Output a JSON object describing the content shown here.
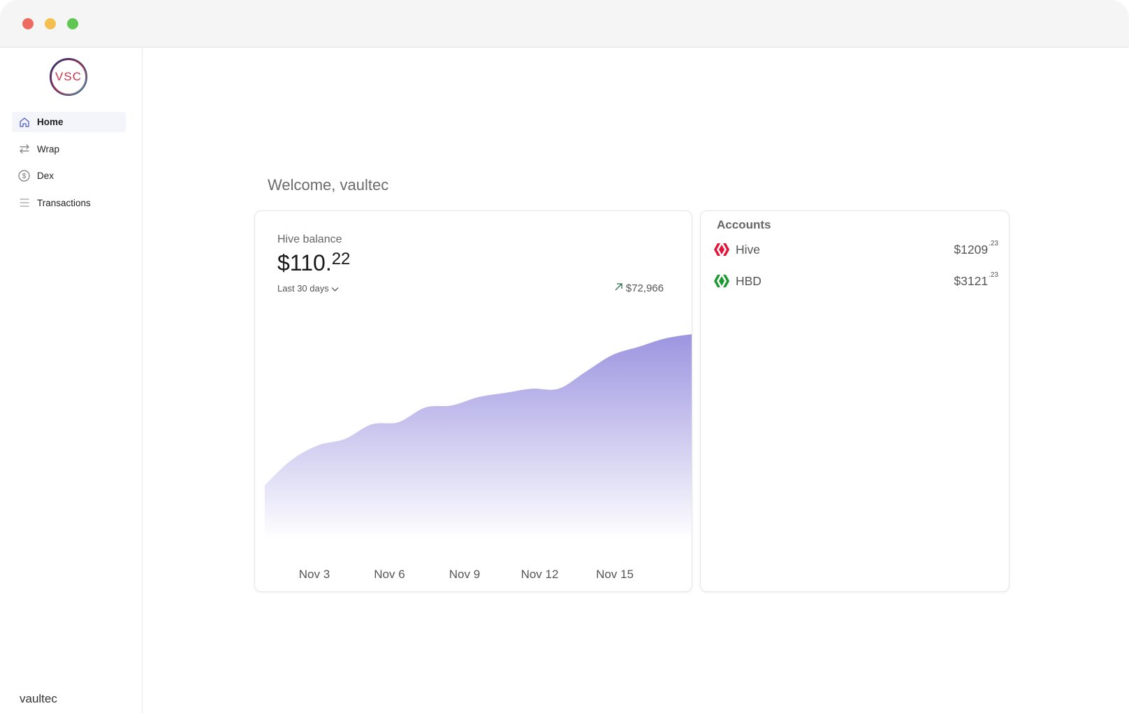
{
  "window": {
    "controls": [
      "close",
      "minimize",
      "zoom"
    ]
  },
  "sidebar": {
    "logo_text": "VSC",
    "items": [
      {
        "label": "Home",
        "icon": "home-icon",
        "active": true
      },
      {
        "label": "Wrap",
        "icon": "swap-arrows-icon",
        "active": false
      },
      {
        "label": "Dex",
        "icon": "dollar-coin-icon",
        "active": false
      },
      {
        "label": "Transactions",
        "icon": "list-icon",
        "active": false
      }
    ],
    "user": "vaultec"
  },
  "main": {
    "welcome": "Welcome, vaultec"
  },
  "balance": {
    "label": "Hive balance",
    "amount_main": "$110.",
    "amount_cents": "22",
    "period": "Last 30 days",
    "change": "$72,966",
    "accent": "#8b82dc"
  },
  "chart_data": {
    "type": "area",
    "x_labels": [
      "Nov 3",
      "Nov 6",
      "Nov 9",
      "Nov 12",
      "Nov 15"
    ],
    "x": [
      0,
      1,
      2,
      3,
      4,
      5,
      6,
      7,
      8,
      9,
      10,
      11,
      12,
      13,
      14,
      15,
      16
    ],
    "values": [
      26,
      38,
      45,
      48,
      55,
      56,
      63,
      64,
      68,
      70,
      72,
      72,
      80,
      88,
      92,
      96,
      98
    ],
    "ylim": [
      0,
      100
    ],
    "grid": false,
    "fill": "#9c95e0"
  },
  "accounts": {
    "title": "Accounts",
    "items": [
      {
        "name": "Hive",
        "value_main": "$1209",
        "value_cents": ".23",
        "icon": "hive-red-icon",
        "color": "#e31337"
      },
      {
        "name": "HBD",
        "value_main": "$3121",
        "value_cents": ".23",
        "icon": "hbd-green-icon",
        "color": "#1a9a2f"
      }
    ]
  }
}
